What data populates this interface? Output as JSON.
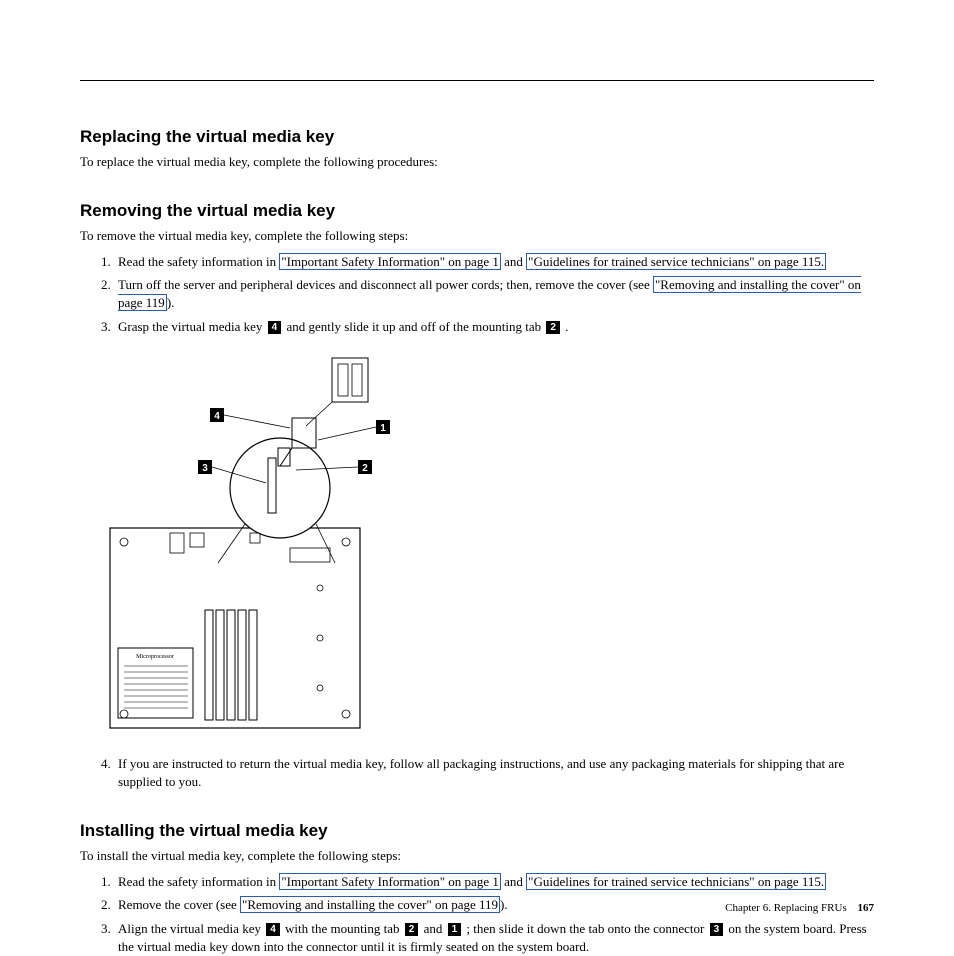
{
  "sec1": {
    "heading": "Replacing the virtual media key",
    "intro": "To replace the virtual media key, complete the following procedures:"
  },
  "sec2": {
    "heading": "Removing the virtual media key",
    "intro": "To remove the virtual media key, complete the following steps:",
    "step1_pre": "Read the safety information in ",
    "link1": "\"Important Safety Information\" on page 1",
    "step1_mid": " and ",
    "link2": "\"Guidelines for trained service technicians\" on page 115.",
    "step2_pre": "Turn off the server and peripheral devices and disconnect all power cords; then, remove the cover (see ",
    "link3": "\"Removing and installing the cover\" on page 119",
    "step2_post": ").",
    "step3_a": "Grasp the virtual media key ",
    "c4": "4",
    "step3_b": " and gently slide it up and off of the mounting tab ",
    "c2": "2",
    "step3_c": " .",
    "step4": "If you are instructed to return the virtual media key, follow all packaging instructions, and use any packaging materials for shipping that are supplied to you."
  },
  "sec3": {
    "heading": "Installing the virtual media key",
    "intro": "To install the virtual media key, complete the following steps:",
    "step1_pre": "Read the safety information in ",
    "link1": "\"Important Safety Information\" on page 1",
    "step1_mid": " and ",
    "link2": "\"Guidelines for trained service technicians\" on page 115.",
    "step2_pre": "Remove the cover (see ",
    "link3": "\"Removing and installing the cover\" on page 119",
    "step2_post": ").",
    "step3_a": "Align the virtual media key ",
    "c4": "4",
    "step3_b": " with the mounting tab ",
    "c2": "2",
    "step3_c": " and ",
    "c1": "1",
    "step3_d": " ; then slide it down the tab onto the connector ",
    "c3": "3",
    "step3_e": " on the system board. Press the virtual media key down into the connector until it is firmly seated on the system board."
  },
  "figure": {
    "c1": "1",
    "c2": "2",
    "c3": "3",
    "c4": "4",
    "micro": "Microprocessor"
  },
  "footer": {
    "chapter": "Chapter 6. Replacing FRUs",
    "page": "167"
  }
}
